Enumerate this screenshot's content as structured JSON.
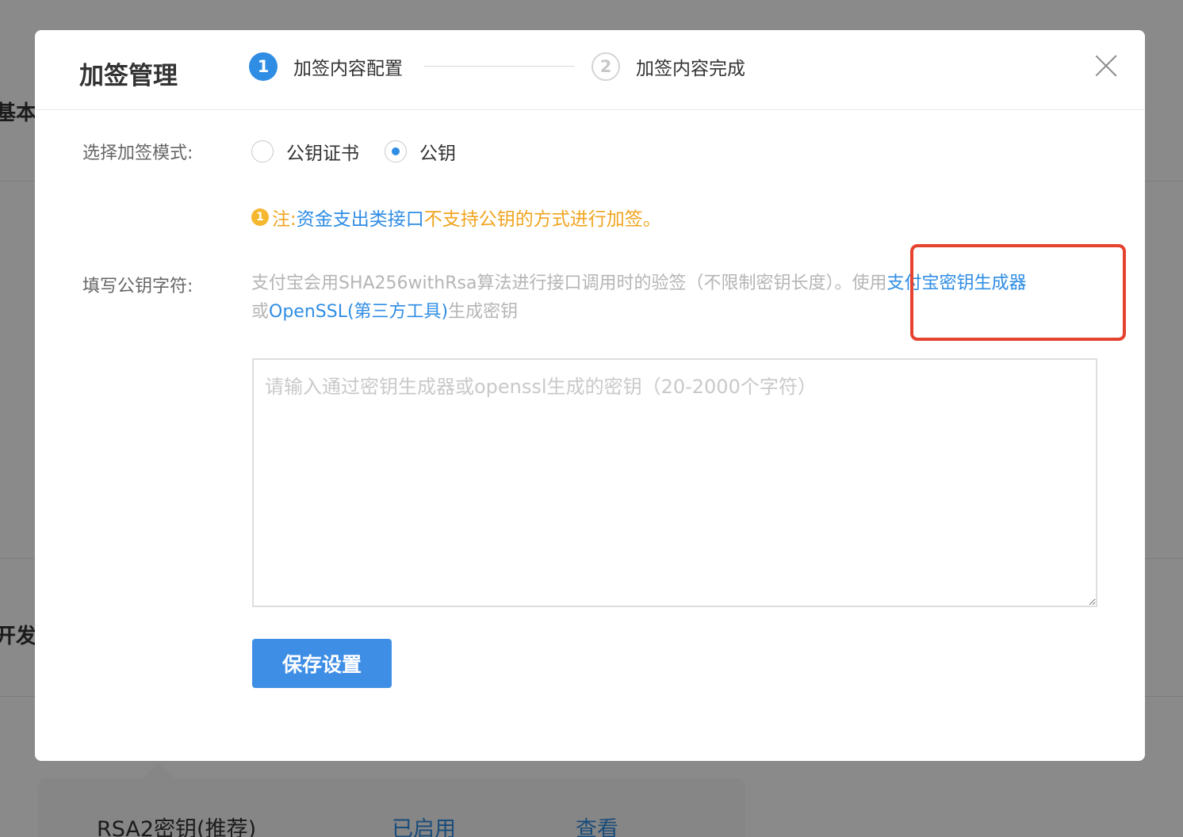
{
  "background": {
    "section_basic": "基本",
    "section_dev": "开发",
    "table_row": {
      "key_type": "RSA2密钥(推荐)",
      "status": "已启用",
      "action": "查看"
    }
  },
  "modal": {
    "title": "加签管理",
    "steps": [
      {
        "number": "1",
        "label": "加签内容配置",
        "state": "active"
      },
      {
        "number": "2",
        "label": "加签内容完成",
        "state": "pending"
      }
    ],
    "close_icon": "close-icon",
    "mode": {
      "label": "选择加签模式:",
      "options": [
        "公钥证书",
        "公钥"
      ],
      "selected": "公钥"
    },
    "note": {
      "icon_text": "1",
      "prefix": "注:",
      "link_text": "资金支出类接口",
      "suffix": "不支持公钥的方式进行加签。"
    },
    "public_key": {
      "label": "填写公钥字符:",
      "desc_part1": "支付宝会用SHA256withRsa算法进行接口调用时的验签（不限制密钥长度）。使用",
      "desc_link1": "支付宝密钥生成器",
      "desc_part2": "或",
      "desc_link2": "OpenSSL(第三方工具)",
      "desc_part3": "生成密钥",
      "placeholder": "请输入通过密钥生成器或openssl生成的密钥（20-2000个字符）",
      "value": ""
    },
    "save_label": "保存设置"
  },
  "colors": {
    "primary": "#2f8de4",
    "warning": "#f0a41f",
    "highlight": "#e5432f"
  }
}
